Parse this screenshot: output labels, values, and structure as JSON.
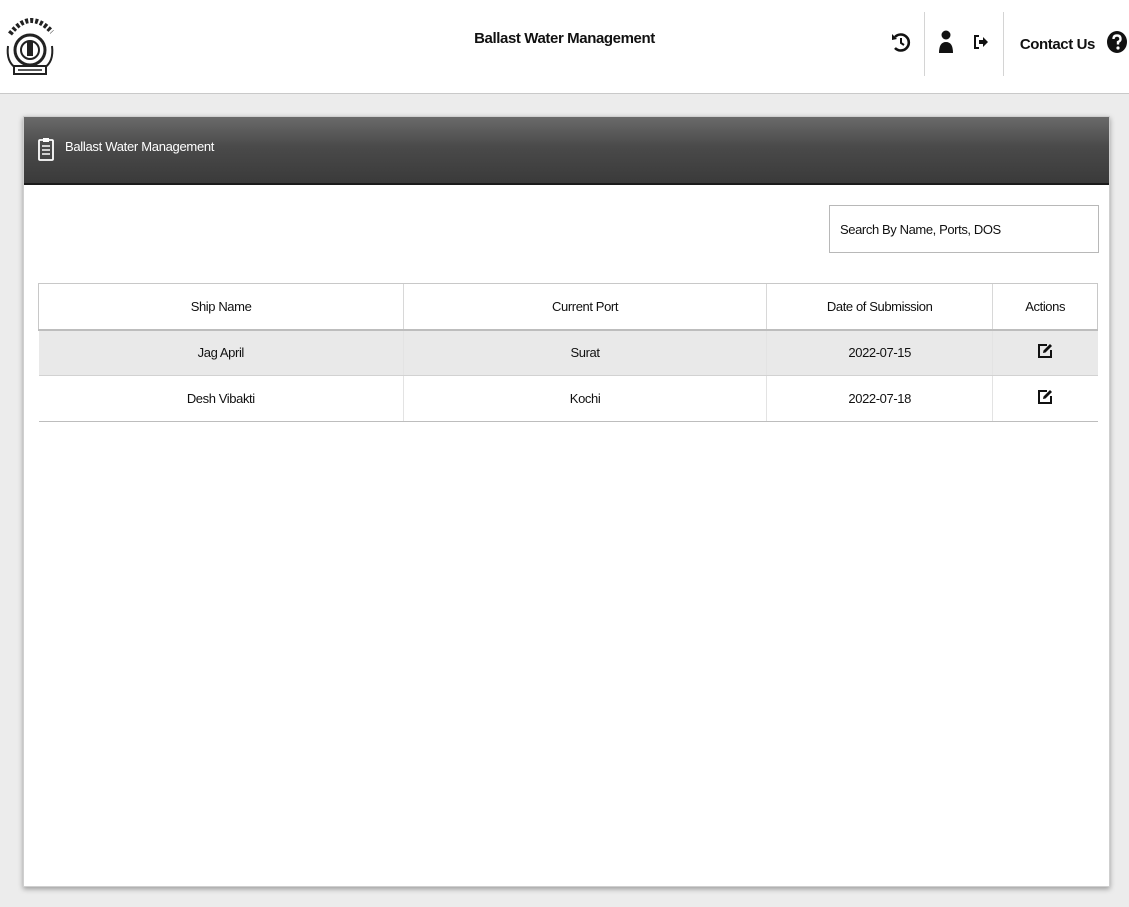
{
  "header": {
    "app_title": "Ballast Water Management",
    "contact_label": "Contact Us",
    "icons": [
      "logo-emblem",
      "history-icon",
      "user-icon",
      "logout-icon",
      "help-icon"
    ]
  },
  "panel": {
    "title": "Ballast Water Management",
    "icon": "clipboard-icon"
  },
  "search": {
    "placeholder": "Search By Name, Ports, DOS",
    "value": ""
  },
  "table": {
    "columns": [
      "Ship Name",
      "Current Port",
      "Date of Submission",
      "Actions"
    ],
    "rows": [
      {
        "ship_name": "Jag April",
        "current_port": "Surat",
        "date_of_submission": "2022-07-15",
        "action_icon": "edit-icon"
      },
      {
        "ship_name": "Desh Vibakti",
        "current_port": "Kochi",
        "date_of_submission": "2022-07-18",
        "action_icon": "edit-icon"
      }
    ]
  },
  "colors": {
    "panel_header": "#4a4a4a",
    "row_highlight": "#e9e9e9",
    "background": "#ececec"
  }
}
